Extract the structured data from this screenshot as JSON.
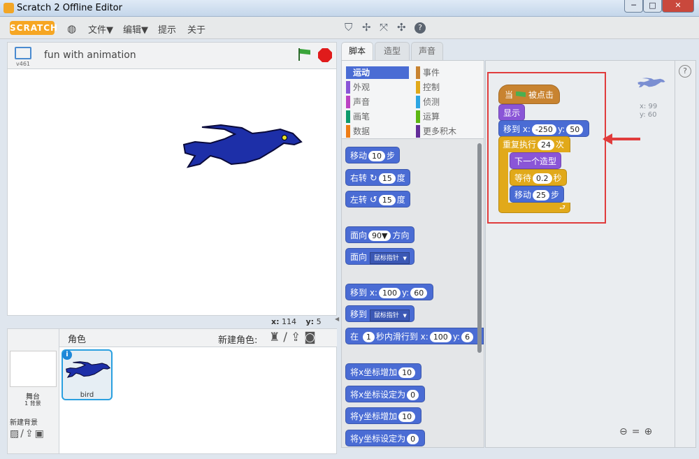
{
  "window": {
    "title": "Scratch 2 Offline Editor"
  },
  "menu": {
    "logo": "SCRATCH",
    "items": [
      "文件▼",
      "编辑▼",
      "提示",
      "关于"
    ]
  },
  "stage": {
    "project_title": "fun with animation",
    "version": "v461",
    "coord_label_x": "x:",
    "coord_x": "114",
    "coord_label_y": "y:",
    "coord_y": "5"
  },
  "tabs": [
    "脚本",
    "造型",
    "声音"
  ],
  "categories": {
    "left": [
      {
        "label": "运动",
        "color": "#4a6cd4"
      },
      {
        "label": "外观",
        "color": "#8a55d7"
      },
      {
        "label": "声音",
        "color": "#bb42c3"
      },
      {
        "label": "画笔",
        "color": "#0e9a6c"
      },
      {
        "label": "数据",
        "color": "#ee7d16"
      }
    ],
    "right": [
      {
        "label": "事件",
        "color": "#c88330"
      },
      {
        "label": "控制",
        "color": "#e1a91a"
      },
      {
        "label": "侦测",
        "color": "#2ca5e2"
      },
      {
        "label": "运算",
        "color": "#5cb712"
      },
      {
        "label": "更多积木",
        "color": "#632d99"
      }
    ]
  },
  "palette": {
    "move": [
      "移动",
      "10",
      "步"
    ],
    "turn_right": [
      "右转",
      "15",
      "度"
    ],
    "turn_left": [
      "左转",
      "15",
      "度"
    ],
    "point_dir": [
      "面向",
      "90▼",
      "方向"
    ],
    "point_towards": [
      "面向",
      "鼠标指针"
    ],
    "goto_xy": [
      "移到 x:",
      "100",
      "y:",
      "60"
    ],
    "goto": [
      "移到",
      "鼠标指针"
    ],
    "glide": [
      "在",
      "1",
      "秒内滑行到 x:",
      "100",
      "y:",
      "6"
    ],
    "change_x": [
      "将x坐标增加",
      "10"
    ],
    "set_x": [
      "将x坐标设定为",
      "0"
    ],
    "change_y": [
      "将y坐标增加",
      "10"
    ],
    "set_y": [
      "将y坐标设定为",
      "0"
    ]
  },
  "script": {
    "hat": [
      "当",
      "被点击"
    ],
    "show": "显示",
    "goto": [
      "移到 x:",
      "-250",
      "y:",
      "50"
    ],
    "repeat": [
      "重复执行",
      "24",
      "次"
    ],
    "next": "下一个造型",
    "wait": [
      "等待",
      "0.2",
      "秒"
    ],
    "move": [
      "移动",
      "25",
      "步"
    ],
    "sprite_x": "x: 99",
    "sprite_y": "y: 60"
  },
  "sprites": {
    "header": "角色",
    "new_sprite": "新建角色:",
    "stage_label": "舞台",
    "stage_bg_count": "1 背景",
    "new_backdrop": "新建背景",
    "sprite_name": "bird",
    "info": "i"
  },
  "help": "?",
  "colors": {
    "motion": "#4a6cd4",
    "looks": "#8a55d7",
    "control": "#e1a91a",
    "events": "#c88330",
    "highlight": "#e03c3c"
  }
}
